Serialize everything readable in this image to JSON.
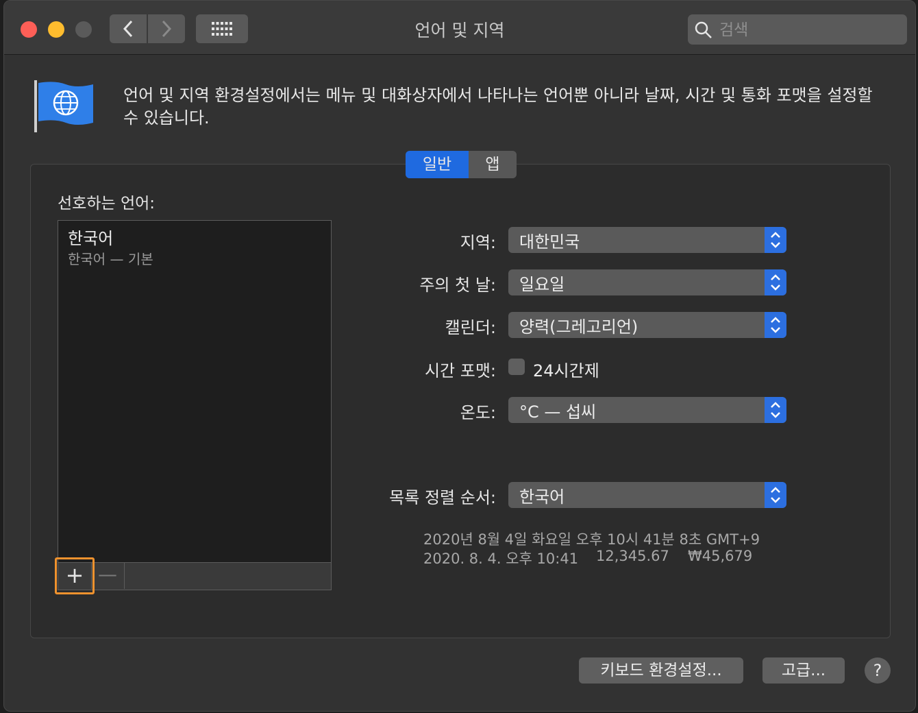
{
  "window": {
    "title": "언어 및 지역"
  },
  "search": {
    "placeholder": "검색"
  },
  "description": "언어 및 지역 환경설정에서는 메뉴 및 대화상자에서 나타나는 언어뿐 아니라 날짜, 시간 및 통화 포맷을 설정할 수 있습니다.",
  "tabs": {
    "general": "일반",
    "apps": "앱",
    "selected": "일반"
  },
  "preferred_languages": {
    "label": "선호하는 언어:",
    "items": [
      {
        "name": "한국어",
        "detail": "한국어 — 기본"
      }
    ],
    "add_label": "+",
    "remove_label": "—"
  },
  "fields": {
    "region": {
      "label": "지역:",
      "value": "대한민국"
    },
    "first_day": {
      "label": "주의 첫 날:",
      "value": "일요일"
    },
    "calendar": {
      "label": "캘린더:",
      "value": "양력(그레고리언)"
    },
    "time_format": {
      "label": "시간 포맷:",
      "checkbox_label": "24시간제",
      "checked": false
    },
    "temperature": {
      "label": "온도:",
      "value": "°C — 섭씨"
    },
    "sort_order": {
      "label": "목록 정렬 순서:",
      "value": "한국어"
    }
  },
  "samples": {
    "long_date": "2020년 8월 4일 화요일 오후 10시 41분 8초 GMT+9",
    "short_date": "2020. 8. 4. 오후 10:41",
    "number": "12,345.67",
    "currency": "₩45,679"
  },
  "buttons": {
    "keyboard": "키보드 환경설정...",
    "advanced": "고급...",
    "help": "?"
  },
  "colors": {
    "accent": "#1f6ae0",
    "focus_ring": "#f0922e",
    "close": "#fe5f57",
    "minimize": "#febc2e"
  }
}
